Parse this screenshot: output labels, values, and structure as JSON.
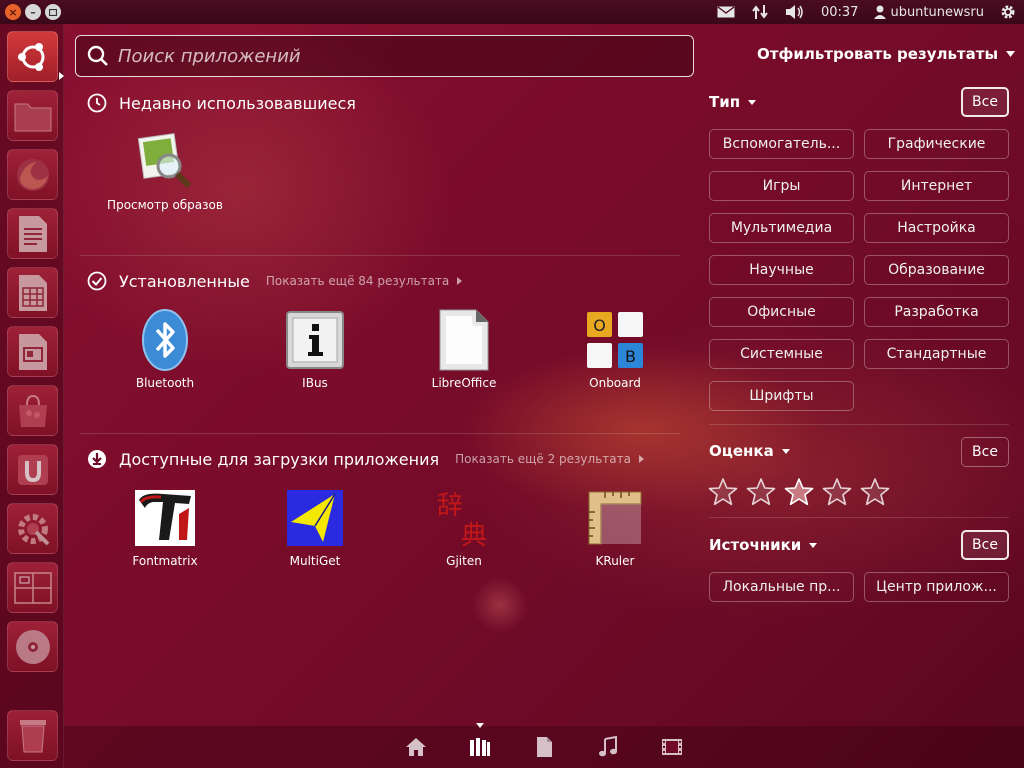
{
  "top_panel": {
    "clock": "00:37",
    "username": "ubuntunewsru"
  },
  "search": {
    "placeholder": "Поиск приложений",
    "value": ""
  },
  "filter_toggle_label": "Отфильтровать результаты",
  "sections": {
    "recent": {
      "title": "Недавно использовавшиеся",
      "apps": [
        {
          "label": "Просмотр образов",
          "icon": "image-viewer-icon"
        }
      ]
    },
    "installed": {
      "title": "Установленные",
      "more": "Показать ещё 84 результата",
      "apps": [
        {
          "label": "Bluetooth",
          "icon": "bluetooth-icon"
        },
        {
          "label": "IBus",
          "icon": "ibus-icon"
        },
        {
          "label": "LibreOffice",
          "icon": "libreoffice-icon"
        },
        {
          "label": "Onboard",
          "icon": "onboard-keyboard-icon"
        }
      ]
    },
    "available": {
      "title": "Доступные для загрузки приложения",
      "more": "Показать ещё 2 результата",
      "apps": [
        {
          "label": "Fontmatrix",
          "icon": "fontmatrix-icon"
        },
        {
          "label": "MultiGet",
          "icon": "multiget-icon"
        },
        {
          "label": "Gjiten",
          "icon": "gjiten-icon"
        },
        {
          "label": "KRuler",
          "icon": "kruler-icon"
        }
      ]
    }
  },
  "filters": {
    "type": {
      "title": "Тип",
      "all_label": "Все",
      "options": [
        "Вспомогатель...",
        "Графические",
        "Игры",
        "Интернет",
        "Мультимедиа",
        "Настройка",
        "Научные",
        "Образование",
        "Офисные",
        "Разработка",
        "Системные",
        "Стандартные",
        "Шрифты"
      ]
    },
    "rating": {
      "title": "Оценка",
      "all_label": "Все",
      "stars_total": 5,
      "highlighted_star": 3
    },
    "sources": {
      "title": "Источники",
      "all_label": "Все",
      "options": [
        "Локальные пр...",
        "Центр прилож..."
      ]
    }
  },
  "gjiten_glyphs": "辞典",
  "onboard_keys": [
    "O",
    "B"
  ],
  "colors": {
    "accent_orange": "#e8632c",
    "background": "#7a0c2a"
  }
}
